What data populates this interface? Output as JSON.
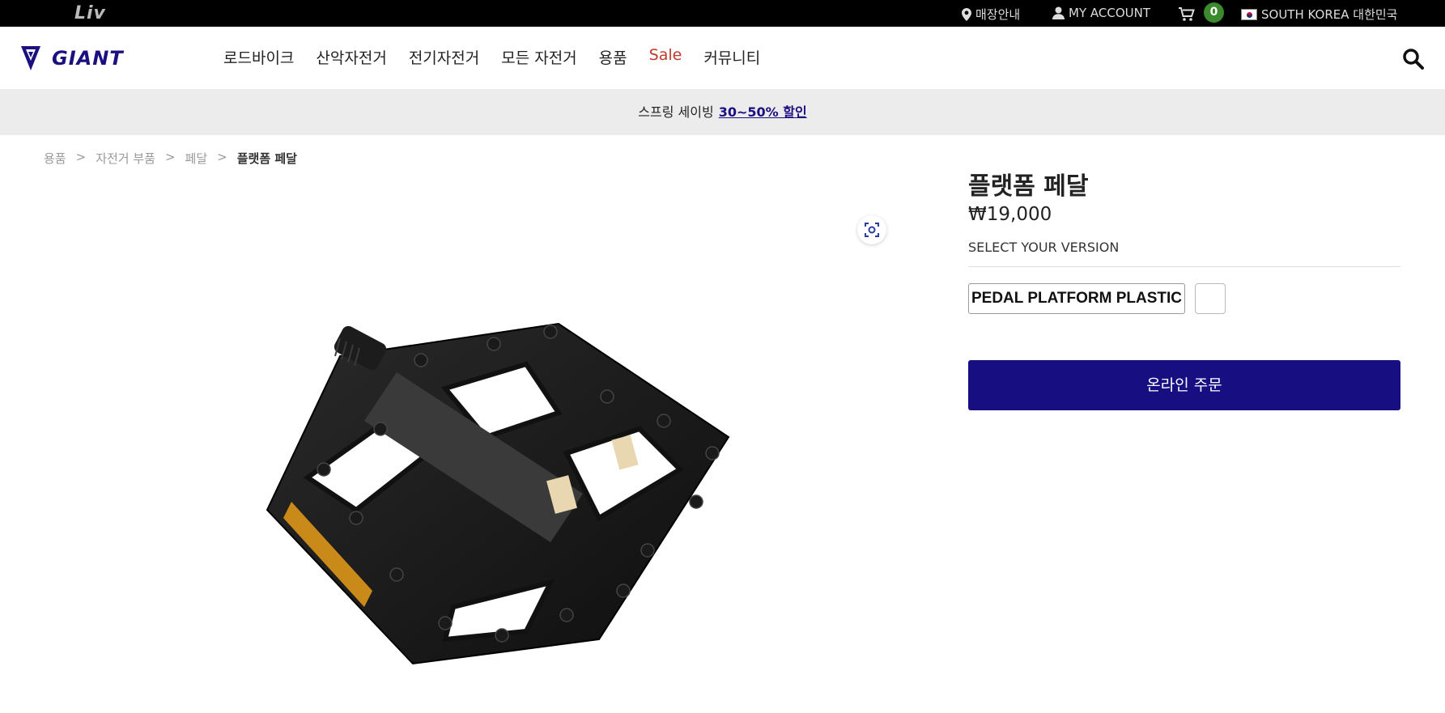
{
  "topbar": {
    "brand_secondary": "Liv",
    "store_label": "매장안내",
    "account_label": "MY ACCOUNT",
    "cart_count": "0",
    "country_label": "SOUTH KOREA 대한민국",
    "icons": [
      "location-pin-icon",
      "user-icon",
      "cart-icon",
      "korea-flag-icon"
    ]
  },
  "header": {
    "brand": "GIANT",
    "nav": [
      {
        "label": "로드바이크"
      },
      {
        "label": "산악자전거"
      },
      {
        "label": "전기자전거"
      },
      {
        "label": "모든 자전거"
      },
      {
        "label": "용품"
      },
      {
        "label": "Sale"
      },
      {
        "label": "커뮤니티"
      }
    ],
    "search_icon": "search-icon"
  },
  "promo": {
    "text": "스프링 세이빙",
    "link": "30~50% 할인"
  },
  "breadcrumb": {
    "items": [
      "용품",
      "자전거 부품",
      "페달"
    ],
    "current": "플랫폼 페달",
    "separator": ">"
  },
  "product": {
    "title": "플랫폼 페달",
    "price": "₩19,000",
    "version_label": "SELECT YOUR VERSION",
    "version_option": "PEDAL PLATFORM PLASTIC",
    "order_button": "온라인 주문",
    "image_alt": "black platform pedal",
    "zoom_icon": "zoom-scan-icon"
  },
  "colors": {
    "brand_navy": "#170e82",
    "sale_red": "#c0392b",
    "cart_badge_green": "#3c8a2e"
  }
}
